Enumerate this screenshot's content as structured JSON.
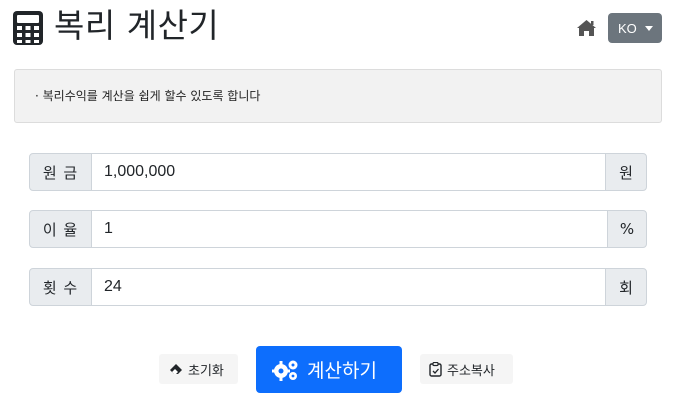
{
  "header": {
    "title": "복리 계산기",
    "title_icon": "calculator-icon",
    "home_icon": "home-icon",
    "language": "KO"
  },
  "notice": {
    "text": "· 복리수익를 계산을 쉽게 할수 있도록 합니다"
  },
  "form": {
    "principal": {
      "label": "원 금",
      "value": "1,000,000",
      "unit": "원"
    },
    "rate": {
      "label": "이 율",
      "value": "1",
      "unit": "%"
    },
    "count": {
      "label": "횟 수",
      "value": "24",
      "unit": "회"
    }
  },
  "actions": {
    "reset_label": "초기화",
    "reset_icon": "eraser-icon",
    "calculate_label": "계산하기",
    "calculate_icon": "cogs-icon",
    "copy_label": "주소복사",
    "copy_icon": "clipboard-icon"
  },
  "colors": {
    "primary": "#0d6efd",
    "secondary": "#6c757d",
    "addon_bg": "#e9ecef",
    "notice_bg": "#f2f2f2"
  }
}
